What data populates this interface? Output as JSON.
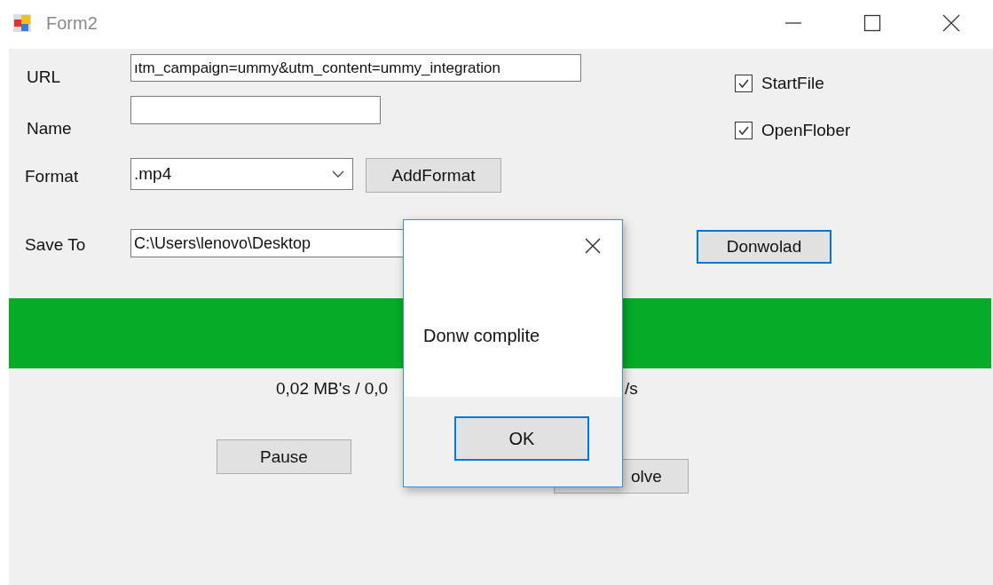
{
  "window": {
    "title": "Form2"
  },
  "form": {
    "fields": [
      {
        "label": "URL",
        "value": "ıtm_campaign=ummy&utm_content=ummy_integration",
        "kind": "text"
      },
      {
        "label": "Name",
        "kind": "text"
      },
      {
        "label": "Format",
        "value": ".mp4",
        "kind": "combo"
      },
      {
        "label": "Save To",
        "value": "C:\\Users\\lenovo\\Desktop",
        "kind": "text"
      }
    ],
    "add_format_button": {
      "label": "AddFormat",
      "focused": false
    },
    "checkboxes": [
      {
        "label": "StartFile",
        "checked": true
      },
      {
        "label": "OpenFlober",
        "checked": true
      }
    ],
    "download_button": {
      "label": "Donwolad",
      "focused": true
    },
    "progress": {
      "level": 1
    },
    "status_parts": [
      "0,02 MB's / 0,0",
      "/s"
    ],
    "pause_button": {
      "label": "Pause",
      "focused": false
    },
    "resolve_button": {
      "label": "olve",
      "focused": false
    }
  },
  "dialog": {
    "message": "Donw complite",
    "ok_button": {
      "label": "OK",
      "focused": true
    }
  }
}
